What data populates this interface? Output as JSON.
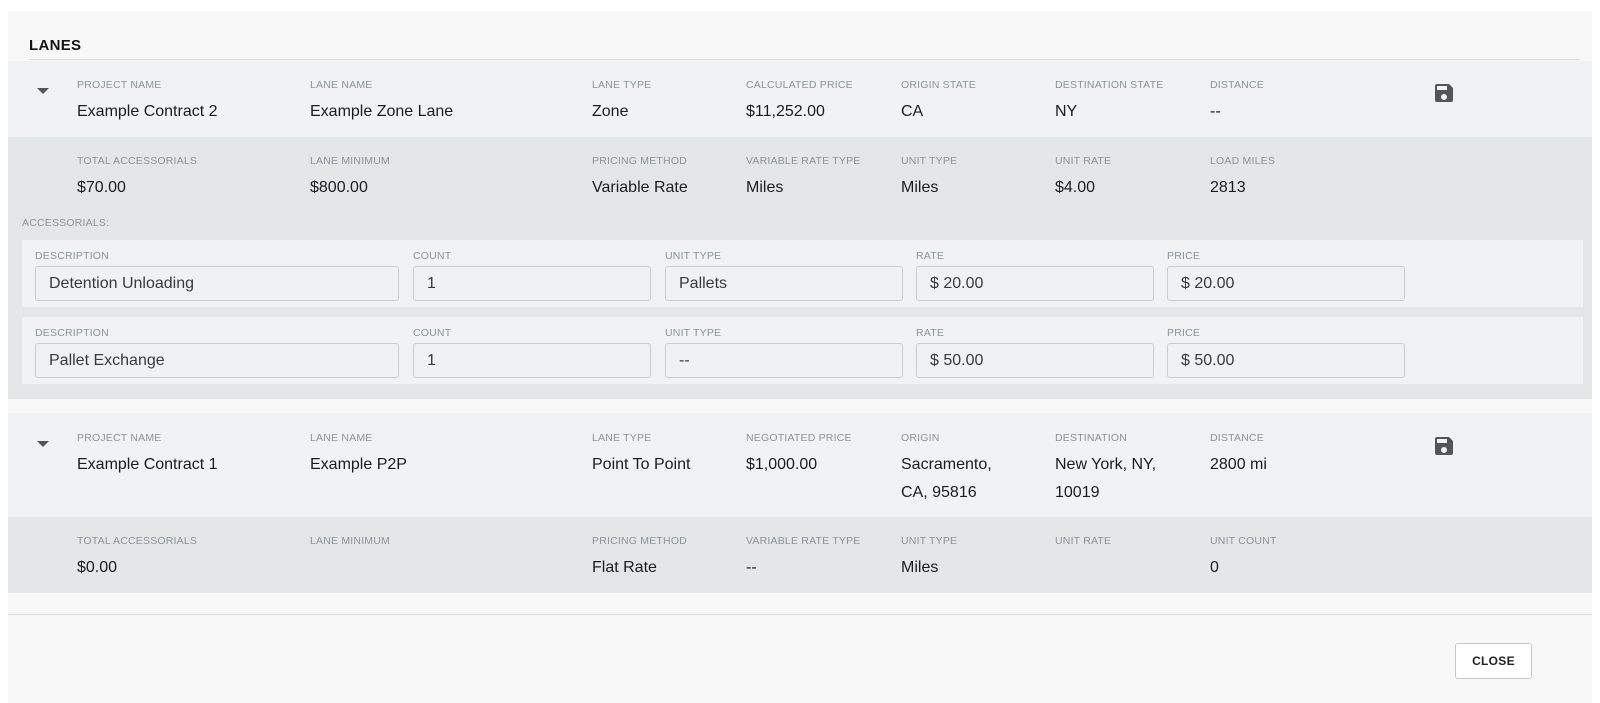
{
  "section": {
    "title": "LANES"
  },
  "lanes": [
    {
      "head": [
        {
          "label": "PROJECT NAME",
          "value": "Example Contract 2"
        },
        {
          "label": "LANE NAME",
          "value": "Example Zone Lane"
        },
        {
          "label": "LANE TYPE",
          "value": "Zone"
        },
        {
          "label": "CALCULATED PRICE",
          "value": "$11,252.00"
        },
        {
          "label": "ORIGIN STATE",
          "value": "CA"
        },
        {
          "label": "DESTINATION STATE",
          "value": "NY"
        },
        {
          "label": "DISTANCE",
          "value": "--"
        }
      ],
      "detail": [
        {
          "label": "TOTAL ACCESSORIALS",
          "value": "$70.00"
        },
        {
          "label": "LANE MINIMUM",
          "value": "$800.00"
        },
        {
          "label": "PRICING METHOD",
          "value": "Variable Rate"
        },
        {
          "label": "VARIABLE RATE TYPE",
          "value": "Miles"
        },
        {
          "label": "UNIT TYPE",
          "value": "Miles"
        },
        {
          "label": "UNIT RATE",
          "value": "$4.00"
        },
        {
          "label": "LOAD MILES",
          "value": "2813"
        }
      ],
      "accessorials_label": "ACCESSORIALS:",
      "accessorials": [
        {
          "description_label": "DESCRIPTION",
          "description": "Detention Unloading",
          "count_label": "COUNT",
          "count": "1",
          "unit_type_label": "UNIT TYPE",
          "unit_type": "Pallets",
          "rate_label": "RATE",
          "rate": "$ 20.00",
          "price_label": "PRICE",
          "price": "$ 20.00"
        },
        {
          "description_label": "DESCRIPTION",
          "description": "Pallet Exchange",
          "count_label": "COUNT",
          "count": "1",
          "unit_type_label": "UNIT TYPE",
          "unit_type": "--",
          "rate_label": "RATE",
          "rate": "$ 50.00",
          "price_label": "PRICE",
          "price": "$ 50.00"
        }
      ]
    },
    {
      "head": [
        {
          "label": "PROJECT NAME",
          "value": "Example Contract 1"
        },
        {
          "label": "LANE NAME",
          "value": "Example P2P"
        },
        {
          "label": "LANE TYPE",
          "value": "Point To Point"
        },
        {
          "label": "NEGOTIATED PRICE",
          "value": "$1,000.00"
        },
        {
          "label": "ORIGIN",
          "value": "Sacramento, CA, 95816"
        },
        {
          "label": "DESTINATION",
          "value": "New York, NY, 10019"
        },
        {
          "label": "DISTANCE",
          "value": "2800 mi"
        }
      ],
      "detail": [
        {
          "label": "TOTAL ACCESSORIALS",
          "value": "$0.00"
        },
        {
          "label": "LANE MINIMUM",
          "value": ""
        },
        {
          "label": "PRICING METHOD",
          "value": "Flat Rate"
        },
        {
          "label": "VARIABLE RATE TYPE",
          "value": "--"
        },
        {
          "label": "UNIT TYPE",
          "value": "Miles"
        },
        {
          "label": "UNIT RATE",
          "value": ""
        },
        {
          "label": "UNIT COUNT",
          "value": "0"
        }
      ]
    }
  ],
  "footer": {
    "close_label": "CLOSE"
  }
}
